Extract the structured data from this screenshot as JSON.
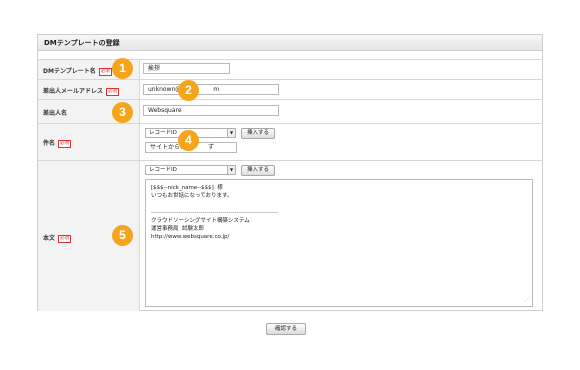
{
  "panel": {
    "title": "DMテンプレートの登録"
  },
  "required_label": "必須",
  "fields": {
    "template_name": {
      "label": "DMテンプレート名",
      "value": "挨拶"
    },
    "sender_email": {
      "label": "差出人メールアドレス",
      "value_left": "unknown@",
      "value_right": "m"
    },
    "sender_name": {
      "label": "差出人名",
      "value": "Websquare"
    },
    "subject": {
      "label": "件名",
      "select_value": "レコードID",
      "insert_button": "挿入する",
      "value_left": "サイトからの",
      "value_right": "ず"
    },
    "body": {
      "label": "本文",
      "select_value": "レコードID",
      "insert_button": "挿入する"
    }
  },
  "body_lines": [
    "[$$$--nick_name--$$$]  様",
    "いつもお世話になっております。",
    "",
    "----------------------------------------------------------------",
    "クラウドソーシングサイト構築システム",
    "運営事務局  試験太郎",
    "http://www.websquare.co.jp/"
  ],
  "badges": [
    "1",
    "2",
    "3",
    "4",
    "5"
  ],
  "confirm_button": "確認する",
  "colors": {
    "badge": "#f5a51c",
    "required": "#d33333"
  }
}
